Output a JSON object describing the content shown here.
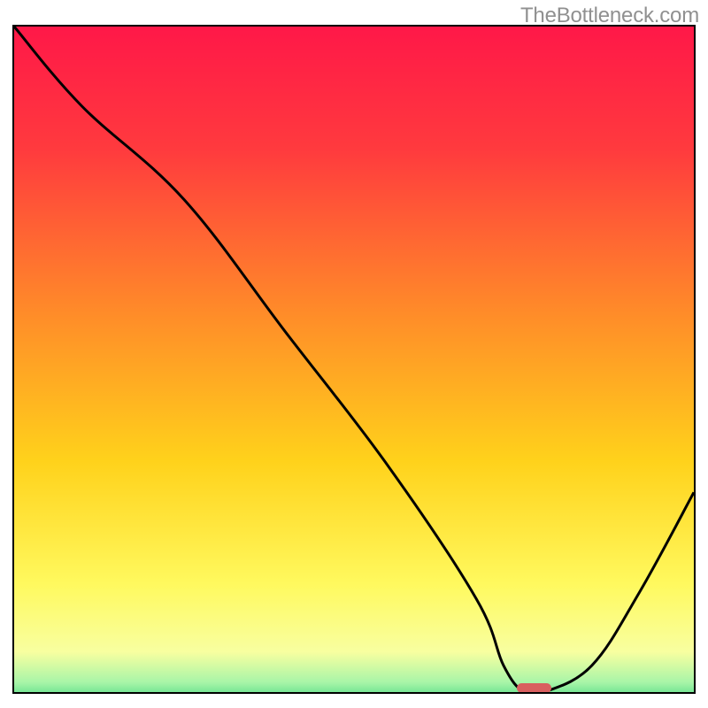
{
  "watermark": "TheBottleneck.com",
  "chart_data": {
    "type": "line",
    "title": "",
    "xlabel": "",
    "ylabel": "",
    "xlim": [
      0,
      100
    ],
    "ylim": [
      0,
      100
    ],
    "x": [
      0,
      10,
      25,
      40,
      55,
      68,
      72,
      75,
      78,
      85,
      92,
      100
    ],
    "values": [
      100,
      88,
      74,
      54,
      34,
      14,
      4,
      0,
      0,
      4,
      15,
      30
    ],
    "gradient_stops": [
      {
        "pos": 0.0,
        "color": "#ff1848"
      },
      {
        "pos": 0.18,
        "color": "#ff3a3e"
      },
      {
        "pos": 0.42,
        "color": "#ff8b29"
      },
      {
        "pos": 0.64,
        "color": "#ffd21b"
      },
      {
        "pos": 0.82,
        "color": "#fff95e"
      },
      {
        "pos": 0.92,
        "color": "#f8ffa0"
      },
      {
        "pos": 0.965,
        "color": "#a8f5a8"
      },
      {
        "pos": 1.0,
        "color": "#34d27a"
      }
    ],
    "marker": {
      "x": 76.5,
      "y": 0.6,
      "w": 5,
      "h": 1.4,
      "color": "#d95f5f"
    }
  }
}
